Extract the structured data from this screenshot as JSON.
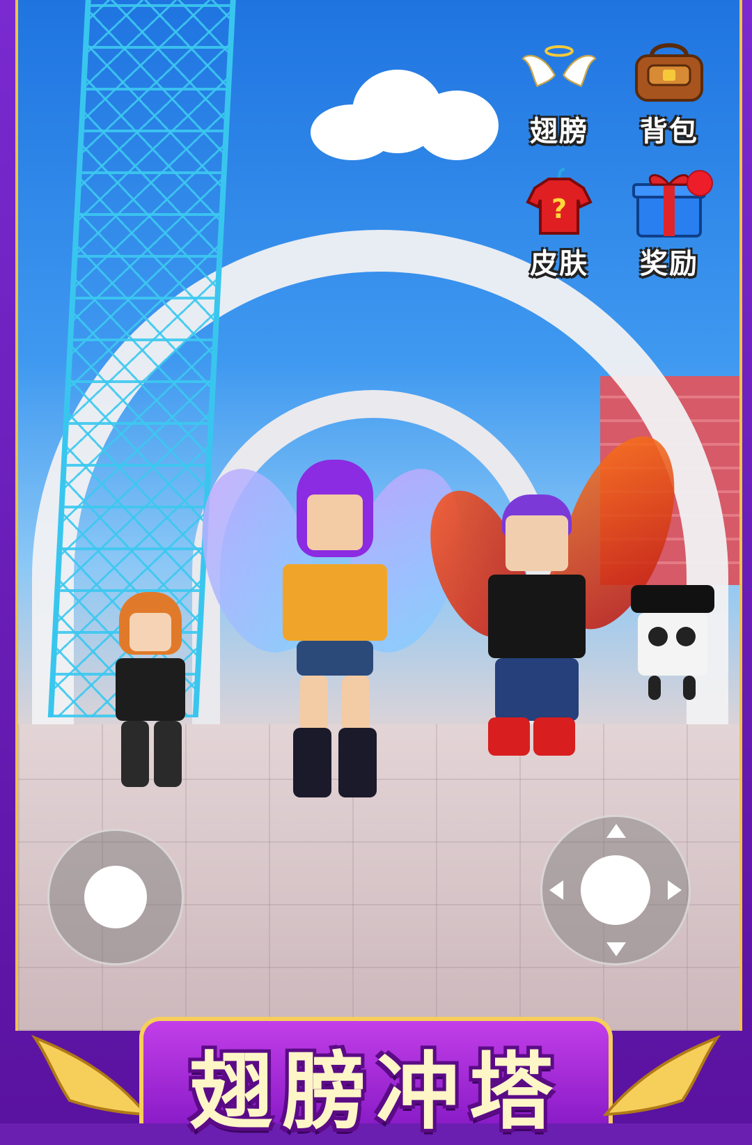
{
  "hud": {
    "wings_label": "翅膀",
    "backpack_label": "背包",
    "skin_label": "皮肤",
    "reward_label": "奖励",
    "reward_has_notification": true
  },
  "banner": {
    "title": "翅膀冲塔"
  },
  "icons": {
    "wings": "angel-wings-halo-icon",
    "backpack": "backpack-icon",
    "skin": "shirt-question-icon",
    "reward": "gift-box-icon"
  },
  "colors": {
    "sky_top": "#1f74e0",
    "banner_purple": "#8a1cc8",
    "banner_gold": "#f6cf5a",
    "notification_red": "#ee1d2a"
  }
}
